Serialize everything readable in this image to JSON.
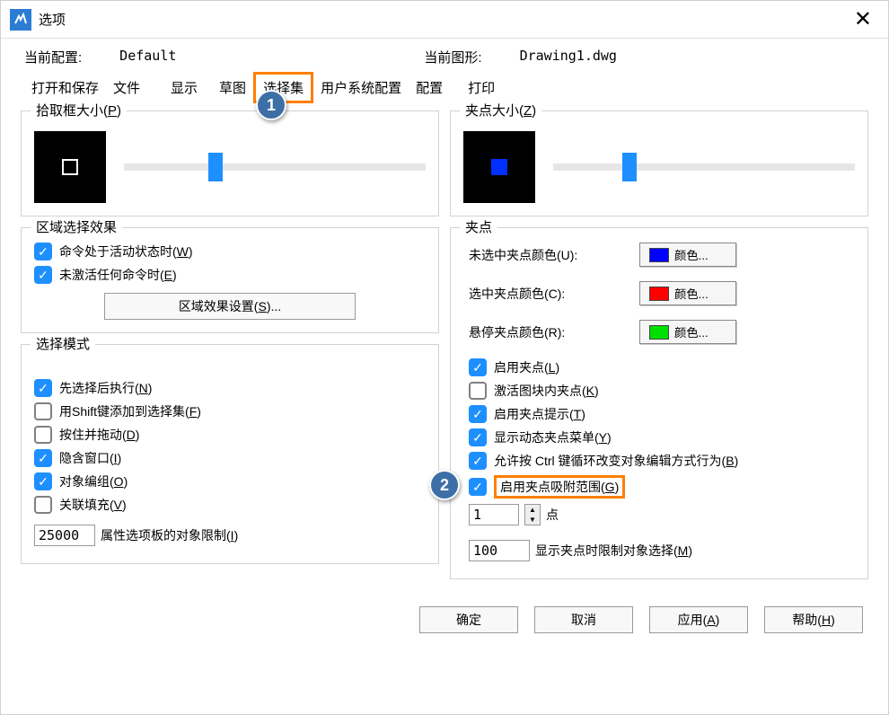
{
  "window": {
    "title": "选项"
  },
  "header": {
    "profile_label": "当前配置:",
    "profile_value": "Default",
    "drawing_label": "当前图形:",
    "drawing_value": "Drawing1.dwg"
  },
  "tabs": {
    "open_save": "打开和保存",
    "file": "文件",
    "display": "显示",
    "draft": "草图",
    "selection": "选择集",
    "user_pref": "用户系统配置",
    "config": "配置",
    "print": "打印"
  },
  "markers": {
    "one": "1",
    "two": "2"
  },
  "left": {
    "pickbox": {
      "title_pre": "拾取框大小(",
      "title_key": "P",
      "title_post": ")"
    },
    "area": {
      "title": "区域选择效果",
      "cmd_active_pre": "命令处于活动状态时(",
      "cmd_active_key": "W",
      "cmd_active_post": ")",
      "no_cmd_pre": "未激活任何命令时(",
      "no_cmd_key": "E",
      "no_cmd_post": ")",
      "settings_btn_pre": "区域效果设置(",
      "settings_btn_key": "S",
      "settings_btn_post": ")..."
    },
    "modes": {
      "title": "选择模式",
      "noun_verb_pre": "先选择后执行(",
      "noun_verb_key": "N",
      "noun_verb_post": ")",
      "shift_add_pre": "用Shift键添加到选择集(",
      "shift_add_key": "F",
      "shift_add_post": ")",
      "press_drag_pre": "按住并拖动(",
      "press_drag_key": "D",
      "press_drag_post": ")",
      "implied_win_pre": "隐含窗口(",
      "implied_win_key": "I",
      "implied_win_post": ")",
      "obj_group_pre": "对象编组(",
      "obj_group_key": "O",
      "obj_group_post": ")",
      "assoc_hatch_pre": "关联填充(",
      "assoc_hatch_key": "V",
      "assoc_hatch_post": ")",
      "limit_value": "25000",
      "limit_label_pre": "属性选项板的对象限制(",
      "limit_label_key": "I",
      "limit_label_post": ")"
    }
  },
  "right": {
    "gripsize": {
      "title_pre": "夹点大小(",
      "title_key": "Z",
      "title_post": ")"
    },
    "grips": {
      "title": "夹点",
      "unsel_label": "未选中夹点颜色(U):",
      "sel_label": "选中夹点颜色(C):",
      "hover_label": "悬停夹点颜色(R):",
      "color_btn": "颜色...",
      "colors": {
        "unsel": "#0000ff",
        "sel": "#ff0000",
        "hover": "#00e000"
      },
      "enable_pre": "启用夹点(",
      "enable_key": "L",
      "enable_post": ")",
      "block_pre": "激活图块内夹点(",
      "block_key": "K",
      "block_post": ")",
      "tips_pre": "启用夹点提示(",
      "tips_key": "T",
      "tips_post": ")",
      "dyn_menu_pre": "显示动态夹点菜单(",
      "dyn_menu_key": "Y",
      "dyn_menu_post": ")",
      "ctrl_cycle_pre": "允许按 Ctrl 键循环改变对象编辑方式行为(",
      "ctrl_cycle_key": "B",
      "ctrl_cycle_post": ")",
      "snap_pre": "启用夹点吸附范围(",
      "snap_key": "G",
      "snap_post": ")",
      "snap_value": "1",
      "snap_unit": "点",
      "limit_value": "100",
      "limit_label_pre": "显示夹点时限制对象选择(",
      "limit_label_key": "M",
      "limit_label_post": ")"
    }
  },
  "buttons": {
    "ok": "确定",
    "cancel": "取消",
    "apply_pre": "应用(",
    "apply_key": "A",
    "apply_post": ")",
    "help_pre": "帮助(",
    "help_key": "H",
    "help_post": ")"
  }
}
